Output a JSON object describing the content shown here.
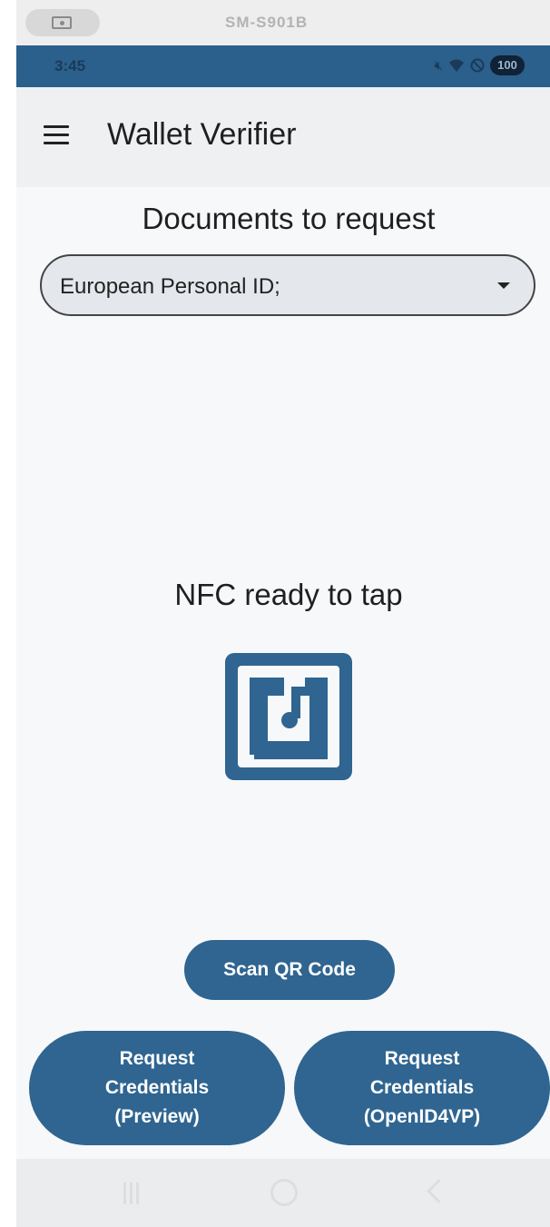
{
  "mirror": {
    "title": "SM-S901B",
    "icon": "screen-mirror-icon"
  },
  "status_bar": {
    "time": "3:45",
    "battery": "100",
    "icons": [
      "mute-icon",
      "wifi-icon",
      "dnd-icon",
      "battery-icon"
    ]
  },
  "app_bar": {
    "title": "Wallet Verifier",
    "menu_icon": "hamburger-menu-icon"
  },
  "documents": {
    "heading": "Documents to request",
    "selected": "European Personal ID;"
  },
  "nfc": {
    "status": "NFC ready to tap",
    "icon": "nfc-icon"
  },
  "buttons": {
    "scan_qr": "Scan QR Code",
    "request_preview": [
      "Request",
      "Credentials",
      "(Preview)"
    ],
    "request_openid": [
      "Request",
      "Credentials",
      "(OpenID4VP)"
    ]
  },
  "colors": {
    "accent": "#2f6590",
    "status_bar": "#2b5f8c",
    "app_bar": "#eef0f2",
    "background": "#f7f8fa"
  }
}
